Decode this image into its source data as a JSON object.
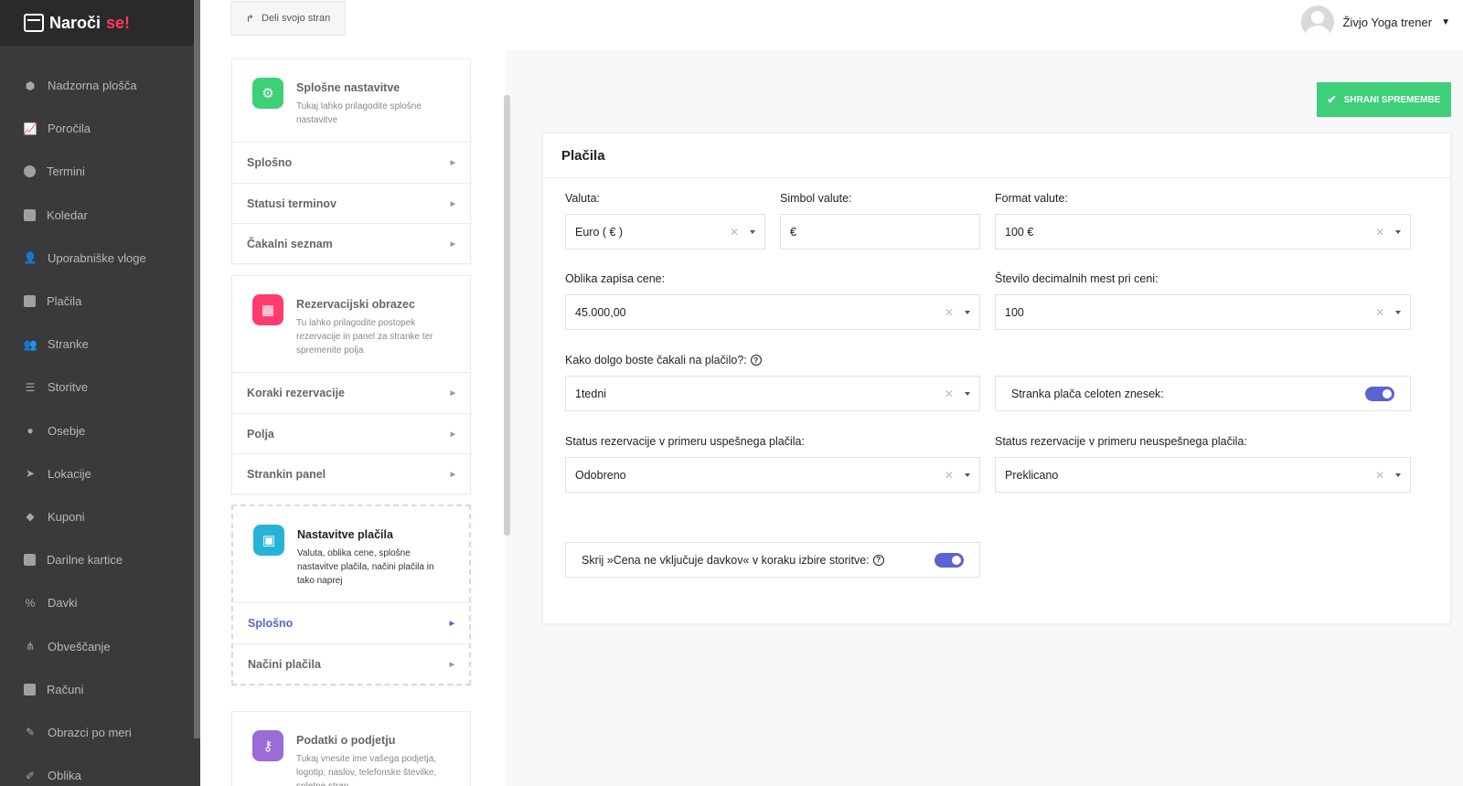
{
  "app": {
    "brand_main": "Naroči",
    "brand_accent": "se!"
  },
  "nav": [
    {
      "label": "Nadzorna plošča",
      "icon": "cube-icon"
    },
    {
      "label": "Poročila",
      "icon": "chart-icon"
    },
    {
      "label": "Termini",
      "icon": "clock-icon"
    },
    {
      "label": "Koledar",
      "icon": "calendar-icon"
    },
    {
      "label": "Uporabniške vloge",
      "icon": "user-plus-icon"
    },
    {
      "label": "Plačila",
      "icon": "card-icon"
    },
    {
      "label": "Stranke",
      "icon": "users-icon"
    },
    {
      "label": "Storitve",
      "icon": "list-icon"
    },
    {
      "label": "Osebje",
      "icon": "person-icon"
    },
    {
      "label": "Lokacije",
      "icon": "location-arrow-icon"
    },
    {
      "label": "Kuponi",
      "icon": "tag-icon"
    },
    {
      "label": "Darilne kartice",
      "icon": "gift-icon"
    },
    {
      "label": "Davki",
      "icon": "percent-icon"
    },
    {
      "label": "Obveščanje",
      "icon": "network-icon"
    },
    {
      "label": "Računi",
      "icon": "invoice-icon"
    },
    {
      "label": "Obrazci po meri",
      "icon": "magic-icon"
    },
    {
      "label": "Oblika",
      "icon": "brush-icon"
    }
  ],
  "topbar": {
    "share_label": "Deli svojo stran",
    "user_name": "Živjo Yoga trener"
  },
  "settings_cards": [
    {
      "title": "Splošne nastavitve",
      "desc": "Tukaj lahko prilagodite splošne nastavitve",
      "items": [
        "Splošno",
        "Statusi terminov",
        "Čakalni seznam"
      ]
    },
    {
      "title": "Rezervacijski obrazec",
      "desc": "Tu lahko prilagodite postopek rezervacije in panel za stranke ter spremenite polja",
      "items": [
        "Koraki rezervacije",
        "Polja",
        "Strankin panel"
      ]
    },
    {
      "title": "Nastavitve plačila",
      "desc": "Valuta, oblika cene, splošne nastavitve plačila, načini plačila in tako naprej",
      "items": [
        "Splošno",
        "Načini plačila"
      ]
    },
    {
      "title": "Podatki o podjetju",
      "desc": "Tukaj vnesite ime vašega podjetja, logotip, naslov, telefonske številke, spletne stran",
      "items": []
    }
  ],
  "colors": {
    "accent": "#5b63d3",
    "save_green": "#3ecf78",
    "card1_icon": "#3ecf78",
    "card2_icon": "#ff3b6e",
    "card3_icon": "#26b3d6",
    "card4_icon": "#9b6bd6"
  },
  "main": {
    "save_label": "SHRANI SPREMEMBE",
    "title": "Plačila",
    "currency": {
      "label": "Valuta:",
      "value": "Euro ( € )"
    },
    "symbol": {
      "label": "Simbol valute:",
      "value": "€"
    },
    "format": {
      "label": "Format valute:",
      "value": "100 €"
    },
    "price_format": {
      "label": "Oblika zapisa cene:",
      "value": "45.000,00"
    },
    "decimals": {
      "label": "Število decimalnih mest pri ceni:",
      "value": "100"
    },
    "wait": {
      "label": "Kako dolgo boste čakali na plačilo?:",
      "value": "1tedni"
    },
    "full_amount": {
      "label": "Stranka plača celoten znesek:",
      "enabled": true
    },
    "status_success": {
      "label": "Status rezervacije v primeru uspešnega plačila:",
      "value": "Odobreno"
    },
    "status_fail": {
      "label": "Status rezervacije v primeru neuspešnega plačila:",
      "value": "Preklicano"
    },
    "hide_tax": {
      "label": "Skrij »Cena ne vključuje davkov« v koraku izbire storitve:",
      "enabled": true
    }
  }
}
